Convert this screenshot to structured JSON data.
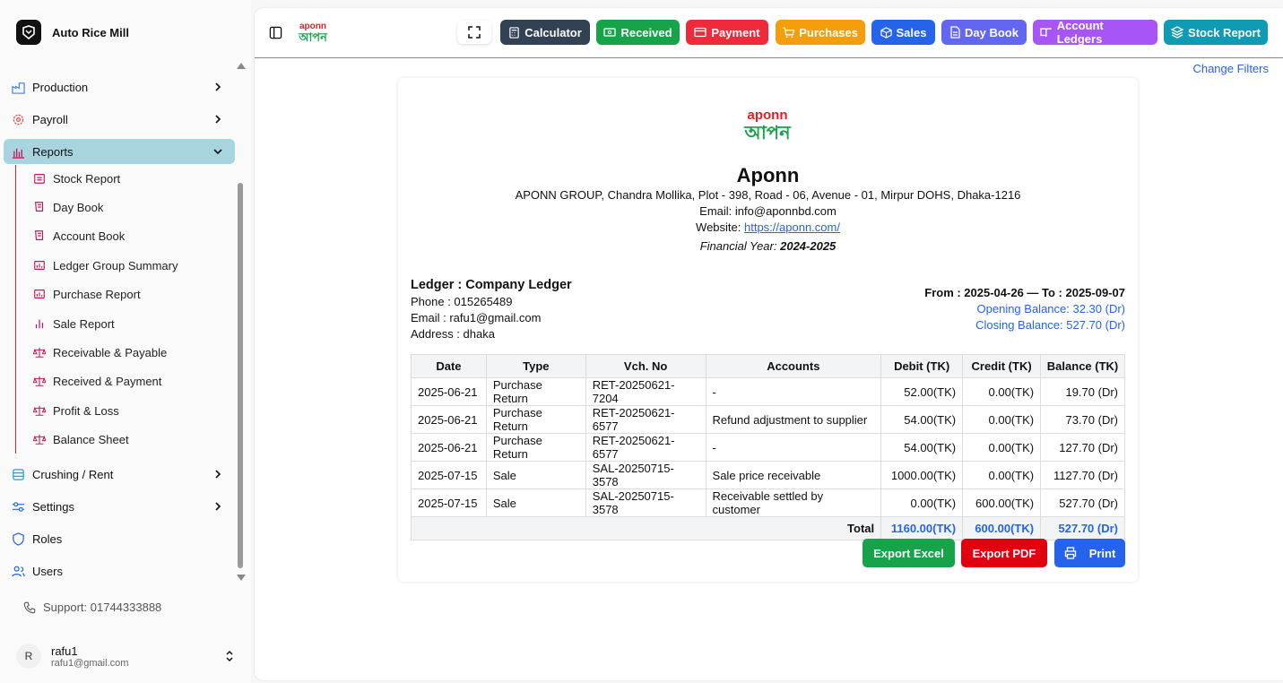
{
  "app": {
    "name": "Auto Rice Mill"
  },
  "sidebar": {
    "items": [
      {
        "label": "Production"
      },
      {
        "label": "Payroll"
      },
      {
        "label": "Reports"
      },
      {
        "label": "Crushing / Rent"
      },
      {
        "label": "Settings"
      },
      {
        "label": "Roles"
      },
      {
        "label": "Users"
      }
    ],
    "reports_sub": [
      {
        "label": "Stock Report"
      },
      {
        "label": "Day Book"
      },
      {
        "label": "Account Book"
      },
      {
        "label": "Ledger Group Summary"
      },
      {
        "label": "Purchase Report"
      },
      {
        "label": "Sale Report"
      },
      {
        "label": "Receivable & Payable"
      },
      {
        "label": "Received & Payment"
      },
      {
        "label": "Profit & Loss"
      },
      {
        "label": "Balance Sheet"
      }
    ],
    "support": "Support: 01744333888",
    "user": {
      "initial": "R",
      "name": "rafu1",
      "email": "rafu1@gmail.com"
    }
  },
  "toolbar": {
    "buttons": [
      {
        "label": "Calculator",
        "color": "#334155"
      },
      {
        "label": "Received",
        "color": "#16a34a"
      },
      {
        "label": "Payment",
        "color": "#ef2a3a"
      },
      {
        "label": "Purchases",
        "color": "#f59e0b"
      },
      {
        "label": "Sales",
        "color": "#2563eb"
      },
      {
        "label": "Day Book",
        "color": "#6366f1"
      },
      {
        "label": "Account Ledgers",
        "color": "#a855f7"
      },
      {
        "label": "Stock Report",
        "color": "#0e9bb3"
      }
    ]
  },
  "change_filters": "Change Filters",
  "company": {
    "logo_text": "aponn",
    "logo_bn": "আপন",
    "name": "Aponn",
    "address": "APONN GROUP, Chandra Mollika, Plot - 398, Road - 06, Avenue - 01, Mirpur DOHS, Dhaka-1216",
    "email_label": "Email:",
    "email": "info@aponnbd.com",
    "website_label": "Website:",
    "website": "https://aponn.com/",
    "fy_label": "Financial Year:",
    "fy": "2024-2025"
  },
  "ledger": {
    "title": "Ledger : Company Ledger",
    "phone": "Phone : 015265489",
    "email": "Email : rafu1@gmail.com",
    "address": "Address : dhaka",
    "range": "From : 2025-04-26 — To : 2025-09-07",
    "opening": "Opening Balance: 32.30 (Dr)",
    "closing": "Closing Balance: 527.70 (Dr)"
  },
  "table": {
    "headers": [
      "Date",
      "Type",
      "Vch. No",
      "Accounts",
      "Debit (TK)",
      "Credit (TK)",
      "Balance (TK)"
    ],
    "rows": [
      [
        "2025-06-21",
        "Purchase Return",
        "RET-20250621-7204",
        "-",
        "52.00(TK)",
        "0.00(TK)",
        "19.70 (Dr)"
      ],
      [
        "2025-06-21",
        "Purchase Return",
        "RET-20250621-6577",
        "Refund adjustment to supplier",
        "54.00(TK)",
        "0.00(TK)",
        "73.70 (Dr)"
      ],
      [
        "2025-06-21",
        "Purchase Return",
        "RET-20250621-6577",
        "-",
        "54.00(TK)",
        "0.00(TK)",
        "127.70 (Dr)"
      ],
      [
        "2025-07-15",
        "Sale",
        "SAL-20250715-3578",
        "Sale price receivable",
        "1000.00(TK)",
        "0.00(TK)",
        "1127.70 (Dr)"
      ],
      [
        "2025-07-15",
        "Sale",
        "SAL-20250715-3578",
        "Receivable settled by customer",
        "0.00(TK)",
        "600.00(TK)",
        "527.70 (Dr)"
      ]
    ],
    "total_label": "Total",
    "total_debit": "1160.00(TK)",
    "total_credit": "600.00(TK)",
    "total_balance": "527.70 (Dr)"
  },
  "actions": {
    "export_excel": "Export Excel",
    "export_pdf": "Export PDF",
    "print": "Print"
  }
}
